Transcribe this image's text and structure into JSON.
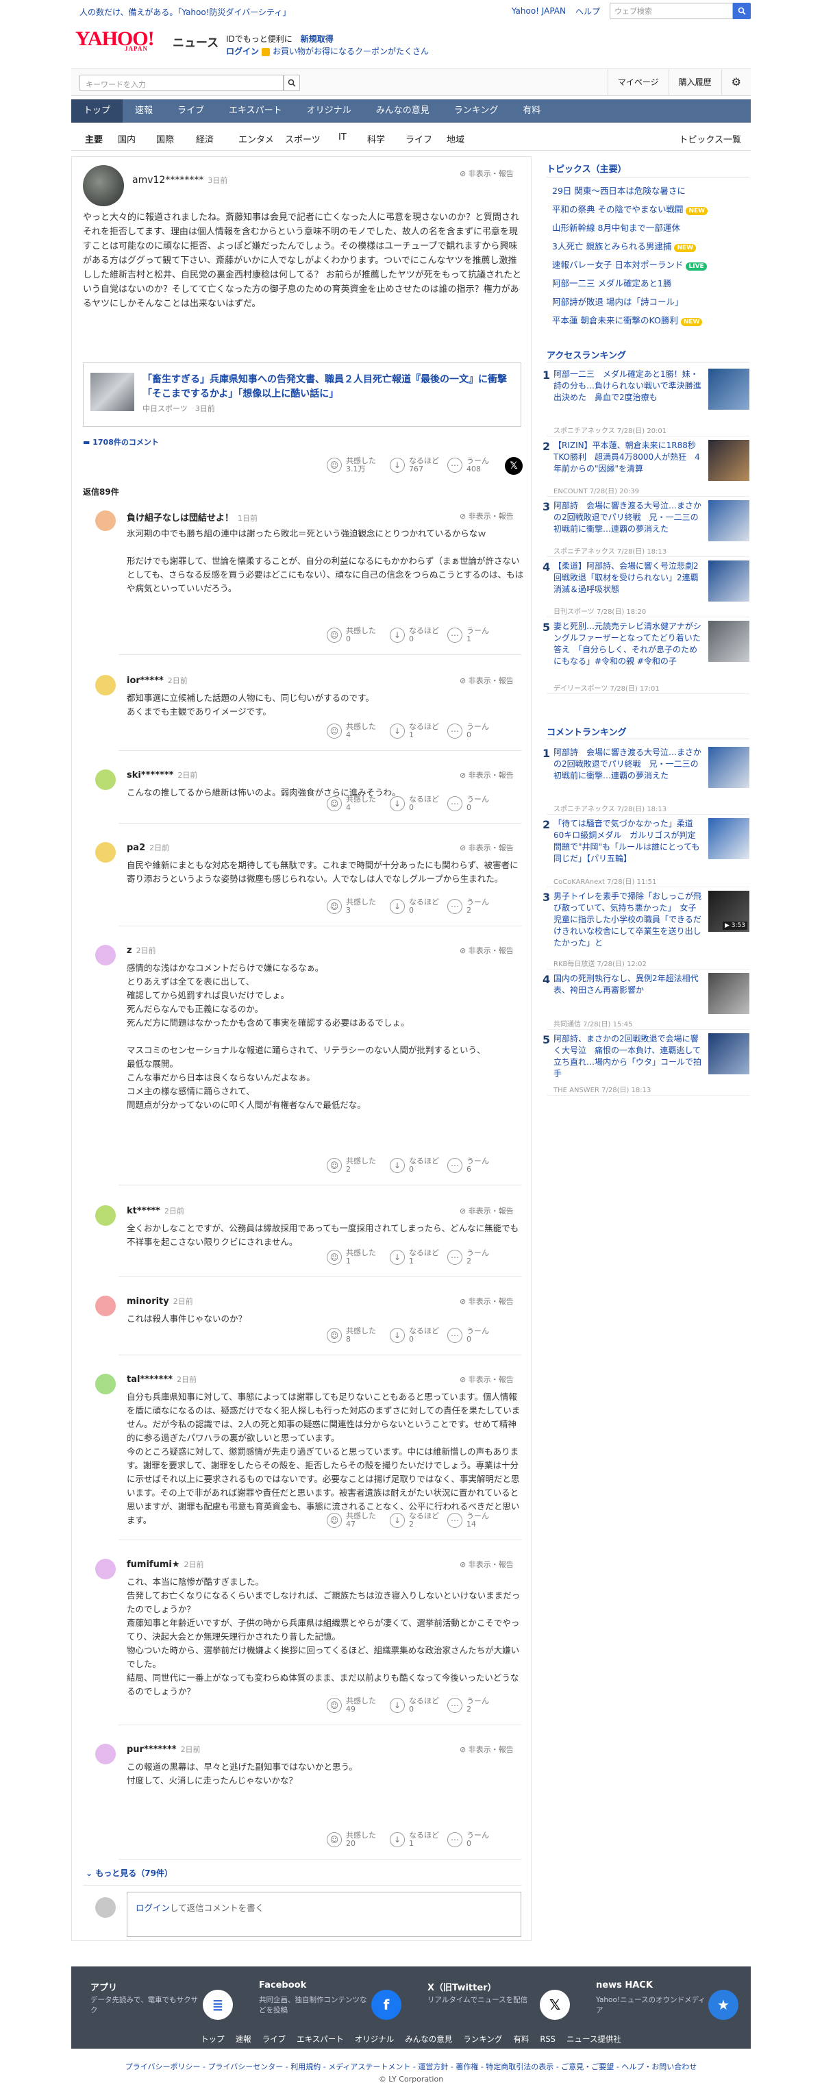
{
  "topbar": {
    "message": "人の数だけ、備えがある。「Yahoo!防災ダイバーシティ」",
    "yahoo_japan": "Yahoo! JAPAN",
    "help": "ヘルプ",
    "search_placeholder": "ウェブ検索"
  },
  "header": {
    "logo": "YAHOO!",
    "logo_sub": "JAPAN",
    "logo_news": "ニュース",
    "id_text": "IDでもっと便利に",
    "register": "新規取得",
    "login": "ログイン",
    "coupon": "お買い物がお得になるクーポンがたくさん"
  },
  "subsearch": {
    "placeholder": "キーワードを入力",
    "mypage": "マイページ",
    "history": "購入履歴"
  },
  "nav": [
    "トップ",
    "速報",
    "ライブ",
    "エキスパート",
    "オリジナル",
    "みんなの意見",
    "ランキング",
    "有料"
  ],
  "subnav": {
    "items": [
      "主要",
      "国内",
      "国際",
      "経済",
      "エンタメ",
      "スポーツ",
      "IT",
      "科学",
      "ライフ",
      "地域"
    ],
    "more": "トピックス一覧"
  },
  "article": {
    "user": "amv12********",
    "time": "3日前",
    "hide": "非表示・報告",
    "body": "やっと大々的に報道されましたね。斎藤知事は会見で記者に亡くなった人に弔意を現さないのか？と質問されそれを拒否してます、理由は個人情報を含むからという意味不明のモノでした、故人の名を含まずに弔意を現すことは可能なのに頑なに拒否、よっぽど嫌だったんでしょう。その模様はユーチューブで観れますから興味がある方はググって観て下さい、斎藤がいかに人でなしがよくわかります。ついでにこんなヤツを推薦し激推しした維新吉村と松井、自民党の裏金西村康稔は何してる？ お前らが推薦したヤツが死をもって抗議されたという自覚はないのか？そしてて亡くなった方の御子息のための育英資金を止めさせたのは誰の指示？権力があるヤツにしかそんなことは出来ないはずだ。",
    "link_title": "「畜生すぎる」兵庫県知事への告発文書、職員２人目死亡報道『最後の一文』に衝撃「そこまでするかよ」「想像以上に酷い話に」",
    "link_source": "中日スポーツ　3日前",
    "comments_link": "1708件のコメント",
    "reactions": [
      {
        "label": "共感した",
        "count": "3.1万",
        "icon": "☺"
      },
      {
        "label": "なるほど",
        "count": "767",
        "icon": "↓"
      },
      {
        "label": "うーん",
        "count": "408",
        "icon": "⋯"
      }
    ]
  },
  "replies_title": "返信89件",
  "replies": [
    {
      "user": "負け組子なしは団結せよ！",
      "time": "1日前",
      "text": "氷河期の中でも勝ち組の連中は謝ったら敗北＝死という強迫観念にとりつかれているからなｗ\n\n形だけでも謝罪して、世論を懐柔することが、自分の利益になるにもかかわらず（まぁ世論が許さないとしても、さらなる反感を買う必要はどこにもない）、頑なに自己の信念をつらぬこうとするのは、もはや病気といっていいだろう。",
      "r": [
        "0",
        "0",
        "1"
      ]
    },
    {
      "user": "ior*****",
      "time": "2日前",
      "text": "都知事選に立候補した話題の人物にも、同じ匂いがするのです。\nあくまでも主観でありイメージです。",
      "r": [
        "4",
        "1",
        "0"
      ]
    },
    {
      "user": "ski*******",
      "time": "2日前",
      "text": "こんなの推してるから維新は怖いのよ。弱肉強食がさらに進みそうわ。",
      "r": [
        "4",
        "0",
        "0"
      ]
    },
    {
      "user": "pa2",
      "time": "2日前",
      "text": "自民や維新にまともな対応を期待しても無駄です。これまで時間が十分あったにも関わらず、被害者に寄り添おうというような姿勢は微塵も感じられない。人でなしは人でなしグループから生まれた。",
      "r": [
        "3",
        "0",
        "2"
      ]
    },
    {
      "user": "z",
      "time": "2日前",
      "text": "感情的な浅はかなコメントだらけで嫌になるなぁ。\nとりあえずは全てを表に出して、\n確認してから処罰すれば良いだけでしょ。\n死んだらなんでも正義になるのか。\n死んだ方に問題はなかったかも含めて事実を確認する必要はあるでしょ。\n\nマスコミのセンセーショナルな報道に踊らされて、リテラシーのない人間が批判するという、\n最低な展開。\nこんな事だから日本は良くならないんだよなぁ。\nコメ主の様な感情に踊らされて、\n問題点が分かってないのに叩く人間が有権者なんで最低だな。",
      "r": [
        "2",
        "0",
        "6"
      ]
    },
    {
      "user": "kt*****",
      "time": "2日前",
      "text": "全くおかしなことですが、公務員は縁故採用であっても一度採用されてしまったら、どんなに無能でも不祥事を起こさない限りクビにされません。",
      "r": [
        "1",
        "1",
        "2"
      ]
    },
    {
      "user": "minority",
      "time": "2日前",
      "text": "これは殺人事件じゃないのか？",
      "r": [
        "8",
        "0",
        "0"
      ]
    },
    {
      "user": "tal*******",
      "time": "2日前",
      "text": "自分も兵庫県知事に対して、事態によっては謝罪しても足りないこともあると思っています。個人情報を盾に頑なになるのは、疑惑だけでなく犯人探しも行った対応のまずさに対しての責任を果たしていません。だが今私の認識では、2人の死と知事の疑惑に関連性は分からないということです。せめて精神的に参る過ぎたパワハラの裏が欲しいと思っています。\n今のところ疑惑に対して、懲罰感情が先走り過ぎていると思っています。中には維新憎しの声もあります。謝罪を要求して、謝罪をしたらその殻を、拒否したらその殻を撮りたいだけでしょう。専業は十分に示せばそれ以上に要求されるものではないです。必要なことは揚げ足取りではなく、事実解明だと思います。その上で非があれば謝罪や責任だと思います。被害者遺族は耐えがたい状況に置かれていると思いますが、謝罪も配慮も弔意も育英資金も、事態に流されることなく、公平に行われるべきだと思います。",
      "r": [
        "47",
        "2",
        "14"
      ]
    },
    {
      "user": "fumifumi★",
      "time": "2日前",
      "text": "これ、本当に陰惨が酷すぎました。\n告発してお亡くなりになるくらいまでしなければ、ご親族たちは泣き寝入りしないといけないままだったのでしょうか？\n斎藤知事と年齢近いですが、子供の時から兵庫県は組織票とやらが凄くて、選挙前活動とかこそでやってり、決起大会とか無理矢理行かされたり昔した記憶。\n物心ついた時から、選挙前だけ機嫌よく挨拶に回ってくるほど、組織票集めな政治家さんたちが大嫌いでした。\n結局、同世代に一番上がなっても変わらぬ体質のまま、まだ以前よりも酷くなって今後いったいどうなるのでしょうか？",
      "r": [
        "49",
        "0",
        "2"
      ]
    },
    {
      "user": "pur*******",
      "time": "2日前",
      "text": "この報道の黒幕は、早々と逃げた副知事ではないかと思う。\n忖度して、火消しに走ったんじゃないかな？",
      "r": [
        "20",
        "1",
        "0"
      ]
    }
  ],
  "reply_labels": [
    "共感した",
    "なるほど",
    "うーん"
  ],
  "more_link": "もっと見る（79件）",
  "reply_box": {
    "login": "ログイン",
    "rest": "して返信コメントを書く"
  },
  "side": {
    "topics_title": "トピックス（主要）",
    "topics": [
      {
        "t": "29日 関東〜西日本は危険な暑さに",
        "b": ""
      },
      {
        "t": "平和の祭典 その陰でやまない戦闘",
        "b": "new"
      },
      {
        "t": "山形新幹線 8月中旬まで一部運休",
        "b": ""
      },
      {
        "t": "3人死亡 親族とみられる男逮捕",
        "b": "new"
      },
      {
        "t": "速報バレー女子 日本対ポーランド",
        "b": "live"
      },
      {
        "t": "阿部一二三 メダル確定あと1勝",
        "b": ""
      },
      {
        "t": "阿部詩が敗退 場内は「詩コール」",
        "b": ""
      },
      {
        "t": "平本蓮 朝倉未来に衝撃のKO勝利",
        "b": "new"
      }
    ],
    "badge_new": "NEW",
    "badge_live": "LIVE",
    "access_title": "アクセスランキング",
    "access": [
      {
        "t": "阿部一二三　メダル確定あと1勝！妹・詩の分も…負けられない戦いで準決勝進出決めた　鼻血で2度治療も",
        "s": "スポニチアネックス 7/28(日) 20:01"
      },
      {
        "t": "【RIZIN】平本蓮、朝倉未来に1R88秒TKO勝利　超満員4万8000人が熱狂　4年前からの\"因縁\"を清算",
        "s": "ENCOUNT 7/28(日) 20:39"
      },
      {
        "t": "阿部詩　会場に響き渡る大号泣…まさかの2回戦敗退でパリ終戦　兄・一二三の初戦前に衝撃…連覇の夢消えた",
        "s": "スポニチアネックス 7/28(日) 18:13"
      },
      {
        "t": "【柔道】阿部詩、会場に響く号泣悲劇2回戦敗退「取材を受けられない」2連覇消滅＆過呼吸状態",
        "s": "日刊スポーツ 7/28(日) 18:20"
      },
      {
        "t": "妻と死別…元読売テレビ清水健アナがシングルファーザーとなってたどり着いた答え　「自分らしく、それが息子のためにもなる」#令和の親 #令和の子",
        "s": "デイリースポーツ 7/28(日) 17:01"
      }
    ],
    "comment_title": "コメントランキング",
    "comments": [
      {
        "t": "阿部詩　会場に響き渡る大号泣…まさかの2回戦敗退でパリ終戦　兄・一二三の初戦前に衝撃…連覇の夢消えた",
        "s": "スポニチアネックス 7/28(日) 18:13"
      },
      {
        "t": "「待ては騒音で気づかなかった」柔道60キロ級銅メダル　ガルリゴスが判定問題で\"井岡\"も「ルールは誰にとっても同じだ」【パリ五輪】",
        "s": "CoCoKARAnext 7/28(日) 11:51"
      },
      {
        "t": "男子トイレを素手で掃除「おしっこが飛び散っていて、気持ち悪かった」　女子児童に指示した小学校の職員「できるだけきれいな校舎にして卒業生を送り出したかった」と",
        "s": "RKB毎日放送 7/28(日) 12:02"
      },
      {
        "t": "国内の死刑執行なし、異例2年超法相代表、袴田さん再審影響か",
        "s": "共同通信 7/28(日) 15:45"
      },
      {
        "t": "阿部詩、まさかの2回戦敗退で会場に響く大号泣　痛恨の一本負け、連覇逃して立ち直れ…場内から「ウタ」コールで拍手",
        "s": "THE ANSWER 7/28(日) 18:13"
      }
    ],
    "video_time": "3:53"
  },
  "footer": {
    "cards": [
      {
        "t": "アプリ",
        "d": "データ先読みで、電車でもサクサク"
      },
      {
        "t": "Facebook",
        "d": "共同企画、独自制作コンテンツなどを投稿"
      },
      {
        "t": "X（旧Twitter）",
        "d": "リアルタイムでニュースを配信"
      },
      {
        "t": "news HACK",
        "d": "Yahoo!ニュースのオウンドメディア"
      }
    ],
    "nav": [
      "トップ",
      "速報",
      "ライブ",
      "エキスパート",
      "オリジナル",
      "みんなの意見",
      "ランキング",
      "有料",
      "RSS",
      "ニュース提供社"
    ],
    "links": "プライバシーポリシー - プライバシーセンター - 利用規約 - メディアステートメント - 運営方針 - 著作権 - 特定商取引法の表示 - ご意見・ご要望 - ヘルプ・お問い合わせ",
    "copyright": "© LY Corporation"
  }
}
